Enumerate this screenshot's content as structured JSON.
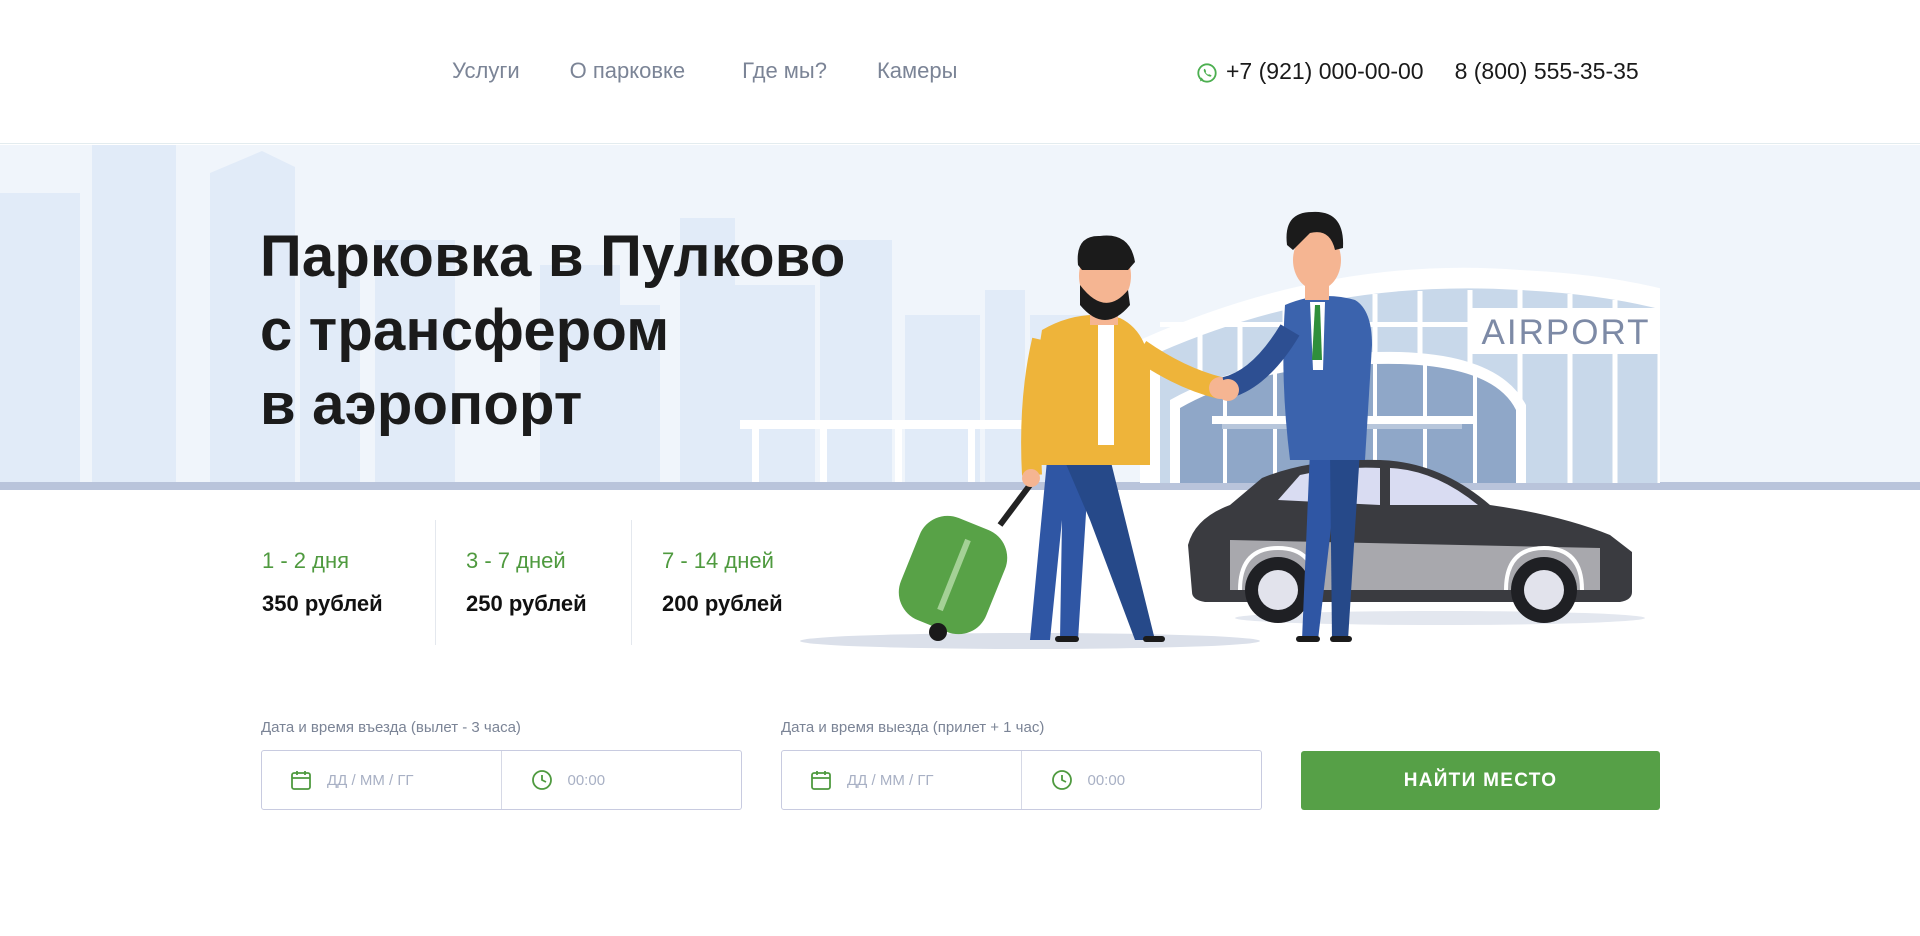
{
  "nav": {
    "items": [
      {
        "label": "Услуги"
      },
      {
        "label": "О парковке"
      },
      {
        "label": "Где мы?"
      },
      {
        "label": "Камеры"
      }
    ]
  },
  "contacts": {
    "whatsapp_icon": "whatsapp-icon",
    "phone_mobile": "+7 (921) 000-00-00",
    "phone_free": "8 (800) 555-35-35"
  },
  "hero": {
    "title_lines": [
      "Парковка в Пулково",
      "с трансфером",
      "в аэропорт"
    ],
    "airport_sign": "AIRPORT"
  },
  "prices": [
    {
      "days": "1 - 2 дня",
      "cost": "350 рублей"
    },
    {
      "days": "3 - 7 дней",
      "cost": "250 рублей"
    },
    {
      "days": "7 - 14 дней",
      "cost": "200 рублей"
    }
  ],
  "form": {
    "entry_label": "Дата и время въезда (вылет - 3 часа)",
    "exit_label": "Дата и время выезда (прилет + 1 час)",
    "date_placeholder": "ДД / ММ / ГГ",
    "time_placeholder": "00:00",
    "submit_label": "НАЙТИ МЕСТО"
  },
  "colors": {
    "accent_green": "#56a047",
    "price_green": "#4f9a3f",
    "nav_gray": "#7b8496",
    "hero_bg": "#f0f5fb"
  }
}
